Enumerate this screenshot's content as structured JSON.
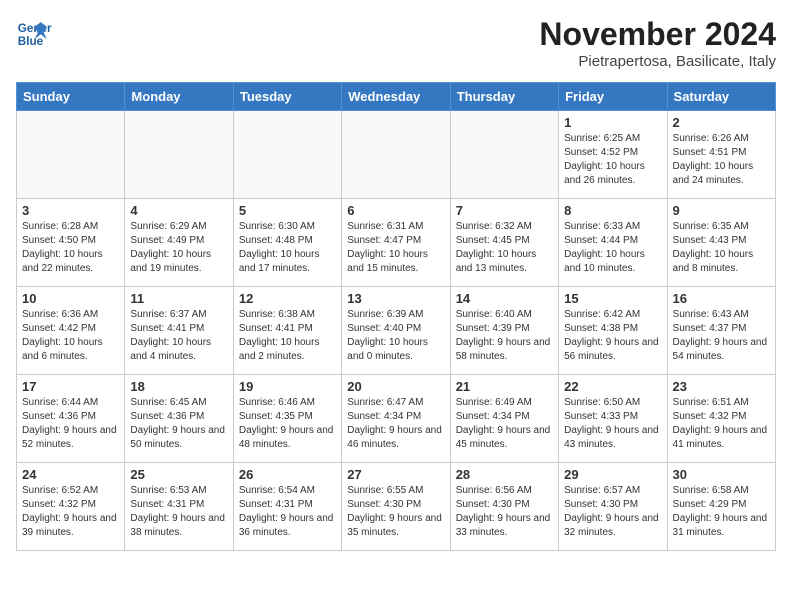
{
  "header": {
    "logo_line1": "General",
    "logo_line2": "Blue",
    "month_title": "November 2024",
    "location": "Pietrapertosa, Basilicate, Italy"
  },
  "weekdays": [
    "Sunday",
    "Monday",
    "Tuesday",
    "Wednesday",
    "Thursday",
    "Friday",
    "Saturday"
  ],
  "weeks": [
    [
      {
        "day": "",
        "info": ""
      },
      {
        "day": "",
        "info": ""
      },
      {
        "day": "",
        "info": ""
      },
      {
        "day": "",
        "info": ""
      },
      {
        "day": "",
        "info": ""
      },
      {
        "day": "1",
        "info": "Sunrise: 6:25 AM\nSunset: 4:52 PM\nDaylight: 10 hours\nand 26 minutes."
      },
      {
        "day": "2",
        "info": "Sunrise: 6:26 AM\nSunset: 4:51 PM\nDaylight: 10 hours\nand 24 minutes."
      }
    ],
    [
      {
        "day": "3",
        "info": "Sunrise: 6:28 AM\nSunset: 4:50 PM\nDaylight: 10 hours\nand 22 minutes."
      },
      {
        "day": "4",
        "info": "Sunrise: 6:29 AM\nSunset: 4:49 PM\nDaylight: 10 hours\nand 19 minutes."
      },
      {
        "day": "5",
        "info": "Sunrise: 6:30 AM\nSunset: 4:48 PM\nDaylight: 10 hours\nand 17 minutes."
      },
      {
        "day": "6",
        "info": "Sunrise: 6:31 AM\nSunset: 4:47 PM\nDaylight: 10 hours\nand 15 minutes."
      },
      {
        "day": "7",
        "info": "Sunrise: 6:32 AM\nSunset: 4:45 PM\nDaylight: 10 hours\nand 13 minutes."
      },
      {
        "day": "8",
        "info": "Sunrise: 6:33 AM\nSunset: 4:44 PM\nDaylight: 10 hours\nand 10 minutes."
      },
      {
        "day": "9",
        "info": "Sunrise: 6:35 AM\nSunset: 4:43 PM\nDaylight: 10 hours\nand 8 minutes."
      }
    ],
    [
      {
        "day": "10",
        "info": "Sunrise: 6:36 AM\nSunset: 4:42 PM\nDaylight: 10 hours\nand 6 minutes."
      },
      {
        "day": "11",
        "info": "Sunrise: 6:37 AM\nSunset: 4:41 PM\nDaylight: 10 hours\nand 4 minutes."
      },
      {
        "day": "12",
        "info": "Sunrise: 6:38 AM\nSunset: 4:41 PM\nDaylight: 10 hours\nand 2 minutes."
      },
      {
        "day": "13",
        "info": "Sunrise: 6:39 AM\nSunset: 4:40 PM\nDaylight: 10 hours\nand 0 minutes."
      },
      {
        "day": "14",
        "info": "Sunrise: 6:40 AM\nSunset: 4:39 PM\nDaylight: 9 hours\nand 58 minutes."
      },
      {
        "day": "15",
        "info": "Sunrise: 6:42 AM\nSunset: 4:38 PM\nDaylight: 9 hours\nand 56 minutes."
      },
      {
        "day": "16",
        "info": "Sunrise: 6:43 AM\nSunset: 4:37 PM\nDaylight: 9 hours\nand 54 minutes."
      }
    ],
    [
      {
        "day": "17",
        "info": "Sunrise: 6:44 AM\nSunset: 4:36 PM\nDaylight: 9 hours\nand 52 minutes."
      },
      {
        "day": "18",
        "info": "Sunrise: 6:45 AM\nSunset: 4:36 PM\nDaylight: 9 hours\nand 50 minutes."
      },
      {
        "day": "19",
        "info": "Sunrise: 6:46 AM\nSunset: 4:35 PM\nDaylight: 9 hours\nand 48 minutes."
      },
      {
        "day": "20",
        "info": "Sunrise: 6:47 AM\nSunset: 4:34 PM\nDaylight: 9 hours\nand 46 minutes."
      },
      {
        "day": "21",
        "info": "Sunrise: 6:49 AM\nSunset: 4:34 PM\nDaylight: 9 hours\nand 45 minutes."
      },
      {
        "day": "22",
        "info": "Sunrise: 6:50 AM\nSunset: 4:33 PM\nDaylight: 9 hours\nand 43 minutes."
      },
      {
        "day": "23",
        "info": "Sunrise: 6:51 AM\nSunset: 4:32 PM\nDaylight: 9 hours\nand 41 minutes."
      }
    ],
    [
      {
        "day": "24",
        "info": "Sunrise: 6:52 AM\nSunset: 4:32 PM\nDaylight: 9 hours\nand 39 minutes."
      },
      {
        "day": "25",
        "info": "Sunrise: 6:53 AM\nSunset: 4:31 PM\nDaylight: 9 hours\nand 38 minutes."
      },
      {
        "day": "26",
        "info": "Sunrise: 6:54 AM\nSunset: 4:31 PM\nDaylight: 9 hours\nand 36 minutes."
      },
      {
        "day": "27",
        "info": "Sunrise: 6:55 AM\nSunset: 4:30 PM\nDaylight: 9 hours\nand 35 minutes."
      },
      {
        "day": "28",
        "info": "Sunrise: 6:56 AM\nSunset: 4:30 PM\nDaylight: 9 hours\nand 33 minutes."
      },
      {
        "day": "29",
        "info": "Sunrise: 6:57 AM\nSunset: 4:30 PM\nDaylight: 9 hours\nand 32 minutes."
      },
      {
        "day": "30",
        "info": "Sunrise: 6:58 AM\nSunset: 4:29 PM\nDaylight: 9 hours\nand 31 minutes."
      }
    ]
  ]
}
